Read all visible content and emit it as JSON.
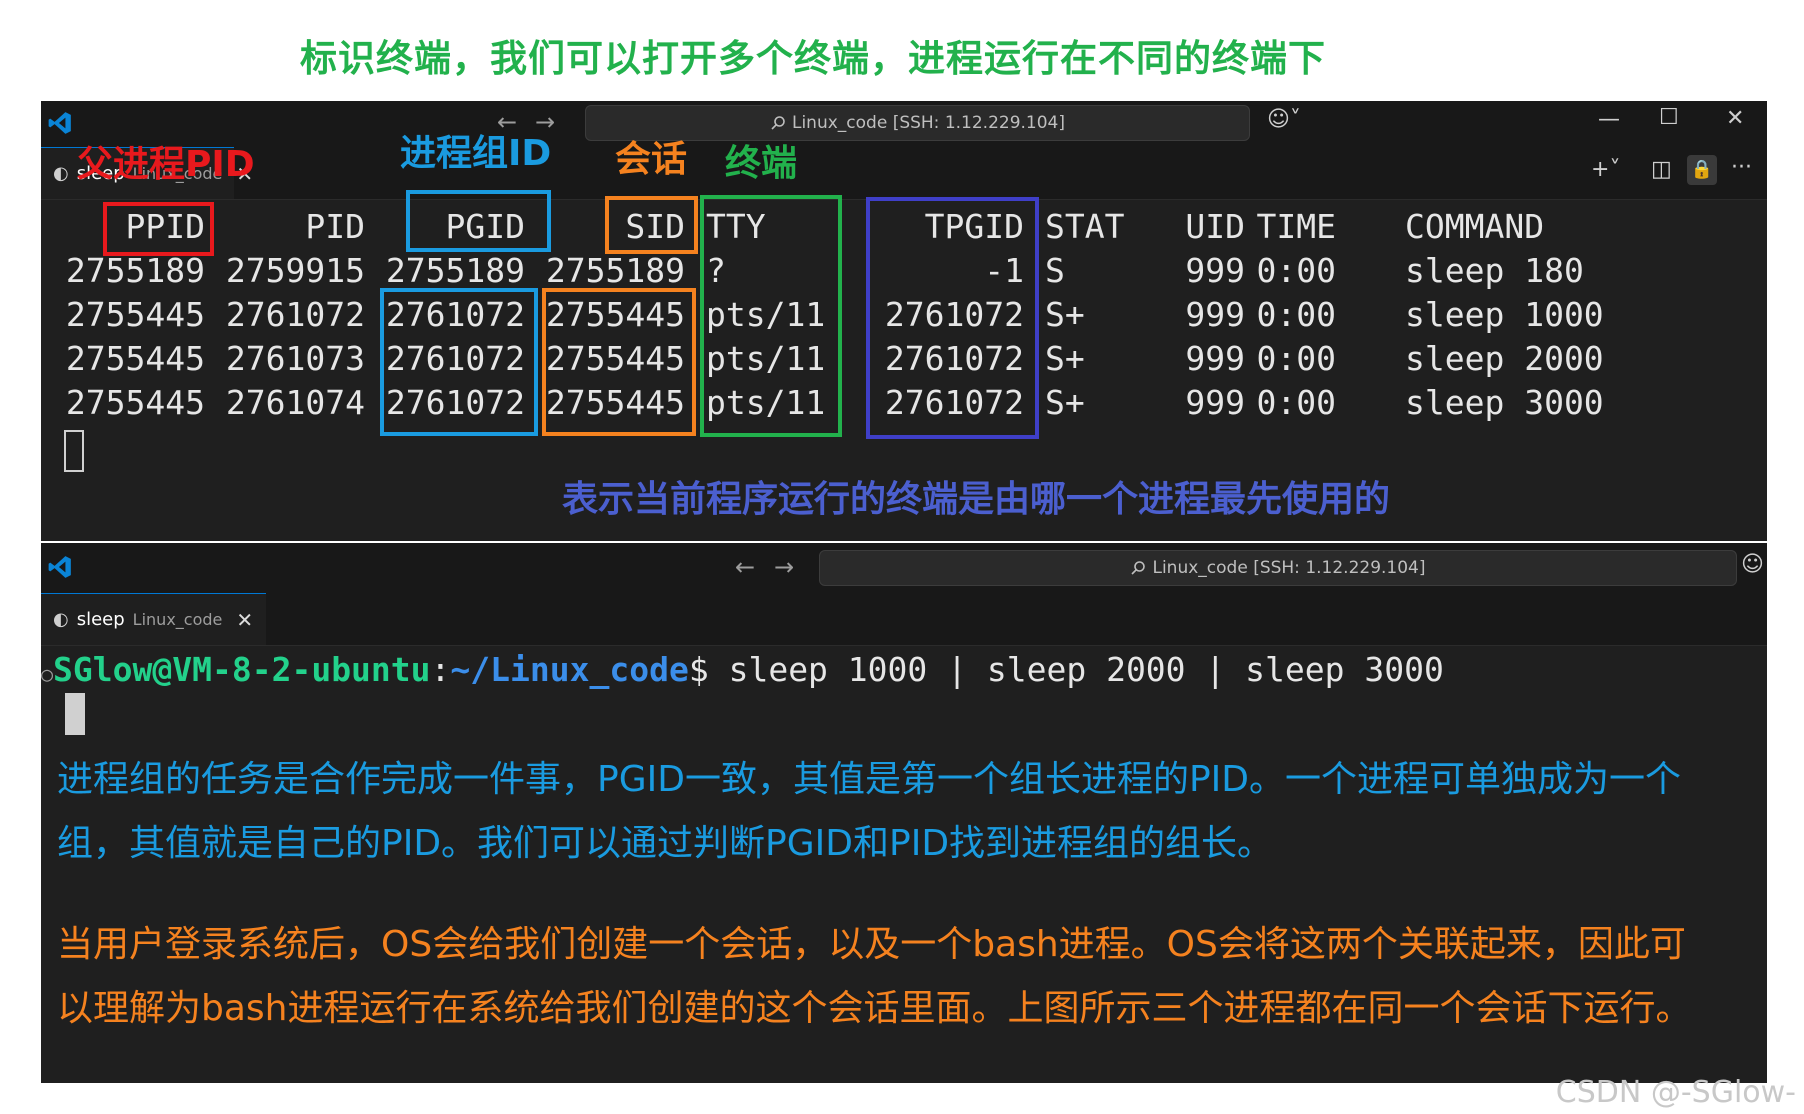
{
  "annotations": {
    "top": "标识终端，我们可以打开多个终端，进程运行在不同的终端下",
    "ppid_label": "父进程PID",
    "pgid_label": "进程组ID",
    "sid_label": "会话",
    "tty_label": "终端",
    "tpgid_note": "表示当前程序运行的终端是由哪一个进程最先使用的",
    "pgid_note": "进程组的任务是合作完成一件事，PGID一致，其值是第一个组长进程的PID。一个进程可单独成为一个组，其值就是自己的PID。我们可以通过判断PGID和PID找到进程组的组长。",
    "pgid_note_line1": "进程组的任务是合作完成一件事，PGID一致，其值是第一个组长进程的PID。一个进程可单独成为一个",
    "pgid_note_line2": "组，其值就是自己的PID。我们可以通过判断PGID和PID找到进程组的组长。",
    "session_note_line1": "当用户登录系统后，OS会给我们创建一个会话，以及一个bash进程。OS会将这两个关联起来，因此可",
    "session_note_line2": "以理解为bash进程运行在系统给我们创建的这个会话里面。上图所示三个进程都在同一个会话下运行。"
  },
  "window1": {
    "search": "Linux_code [SSH: 1.12.229.104]",
    "tab_name": "sleep",
    "tab_sub": "Linux_code",
    "controls": {
      "plus": "+",
      "more": "···"
    }
  },
  "window2": {
    "search": "Linux_code [SSH: 1.12.229.104]",
    "tab_name": "sleep",
    "tab_sub": "Linux_code"
  },
  "ps_table": {
    "headers": [
      "PPID",
      "PID",
      "PGID",
      "SID",
      "TTY",
      "TPGID",
      "STAT",
      "UID",
      "TIME",
      "COMMAND"
    ],
    "rows": [
      [
        "2755189",
        "2759915",
        "2755189",
        "2755189",
        "?",
        "-1",
        "S",
        "999",
        "0:00",
        "sleep 180"
      ],
      [
        "2755445",
        "2761072",
        "2761072",
        "2755445",
        "pts/11",
        "2761072",
        "S+",
        "999",
        "0:00",
        "sleep 1000"
      ],
      [
        "2755445",
        "2761073",
        "2761072",
        "2755445",
        "pts/11",
        "2761072",
        "S+",
        "999",
        "0:00",
        "sleep 2000"
      ],
      [
        "2755445",
        "2761074",
        "2761072",
        "2755445",
        "pts/11",
        "2761072",
        "S+",
        "999",
        "0:00",
        "sleep 3000"
      ]
    ]
  },
  "terminal2": {
    "prompt_user": "SGlow@VM-8-2-ubuntu",
    "prompt_sep": ":",
    "prompt_path": "~/Linux_code",
    "prompt_end": "$",
    "command": " sleep 1000 | sleep 2000 | sleep 3000"
  },
  "watermark": "CSDN @-SGlow-",
  "colors": {
    "red": "#e8191d",
    "blue": "#1a9be0",
    "orange": "#f5821f",
    "green": "#22b14c",
    "navy": "#3f3fc8"
  }
}
